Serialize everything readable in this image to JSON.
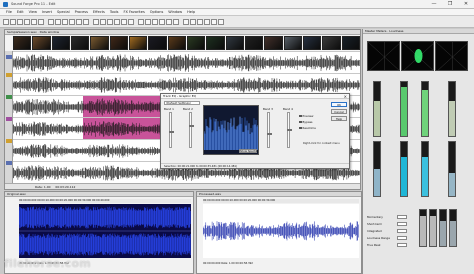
{
  "window": {
    "title": "Sound Forge Pro 11 - Edit",
    "controls": [
      "—",
      "❐",
      "✕"
    ]
  },
  "menu": [
    "File",
    "Edit",
    "View",
    "Insert",
    "Special",
    "Process",
    "Effects",
    "Tools",
    "FX Favorites",
    "Options",
    "Window",
    "Help"
  ],
  "toolbar": {
    "icon_count": 30
  },
  "editor": {
    "header": "SampleSession.wav  ·  Data window",
    "thumb_count": 18,
    "status_time": "00:03:20.112",
    "status_text": "Rate: 1.00"
  },
  "eq_dialog": {
    "title": "Track EQ - Graphic EQ",
    "preset": "(Default Settings)",
    "close_glyph": "×",
    "band_labels": [
      "Band 1",
      "Band 2",
      "Band 3",
      "Band 4"
    ],
    "spectrum_button": "Show Spectrum",
    "buttons": {
      "ok": "OK",
      "cancel": "Cancel",
      "help": "Help"
    },
    "checks": [
      "Preview",
      "Bypass",
      "Real-time"
    ],
    "note": "Right-click for context menu",
    "footer": "Selection: 00:00:21.000 to 00:00:35.481  (00:00:14.481)"
  },
  "meters": {
    "header": "Master Meters  ·  Loudness",
    "scope_dot_color": "#39ff79",
    "levels_upper": [
      0.64,
      0.9,
      0.86,
      0.64
    ],
    "levels_lower": [
      0.5,
      0.72,
      0.72,
      0.42
    ],
    "colors_upper": [
      "#b8c8a8",
      "#59c96e",
      "#6fd37b",
      "#c0ccb4"
    ],
    "colors_lower": [
      "#8fb4c8",
      "#1fb6d6",
      "#3cc0de",
      "#96b6c6"
    ],
    "loudness_labels": [
      "Momentary",
      "Short-term",
      "Integrated",
      "Loudness Range",
      "True Peak"
    ],
    "small_bars": [
      0.82,
      0.82,
      0.7,
      0.7
    ]
  },
  "bottom_left": {
    "header": "Original.wav",
    "ruler": "00:00:00.000      00:00:10.000      00:00:20.000      00:00:30.000      00:00:40.000",
    "status": "00:00:00.000     Rate: 1.00     00:00:58.392"
  },
  "bottom_right": {
    "header": "Processed.wav",
    "ruler": "00:00:00.000      00:00:10.000      00:00:20.000      00:00:30.000",
    "status": "00:00:00.000     Rate: 1.00     00:00:58.392"
  },
  "watermark": "filehorse.com"
}
